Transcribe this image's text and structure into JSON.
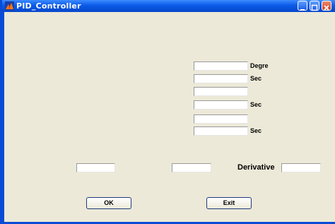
{
  "window": {
    "title": "PID_Controller",
    "icon": "matlab-icon",
    "controls": [
      "minimize-icon",
      "maximize-icon",
      "close-icon"
    ]
  },
  "fields": [
    {
      "value": "",
      "unit": "Degre"
    },
    {
      "value": "",
      "unit": "Sec"
    },
    {
      "value": "",
      "unit": ""
    },
    {
      "value": "",
      "unit": "Sec"
    },
    {
      "value": "",
      "unit": ""
    },
    {
      "value": "",
      "unit": "Sec"
    }
  ],
  "bottom_row": {
    "field1": "",
    "field2": "",
    "derivative_label": "Derivative",
    "derivative_value": ""
  },
  "buttons": {
    "ok_label": "OK",
    "exit_label": "Exit"
  },
  "colors": {
    "titlebar": "#0a5ae8",
    "background": "#ece9d8"
  }
}
